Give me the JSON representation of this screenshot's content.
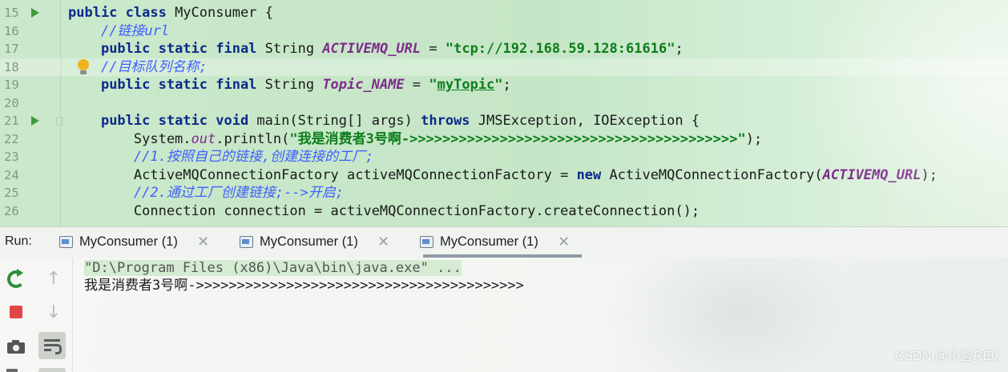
{
  "editor": {
    "lines": [
      {
        "no": "15",
        "run": true,
        "segments": [
          {
            "t": "public class ",
            "c": "kw"
          },
          {
            "t": "MyConsumer {",
            "c": "plain"
          }
        ]
      },
      {
        "no": "16",
        "segments": [
          {
            "t": "    ",
            "c": "plain"
          },
          {
            "t": "//链接url",
            "c": "cmt"
          }
        ]
      },
      {
        "no": "17",
        "segments": [
          {
            "t": "    ",
            "c": "plain"
          },
          {
            "t": "public static final ",
            "c": "kw"
          },
          {
            "t": "String ",
            "c": "plain"
          },
          {
            "t": "ACTIVEMQ_URL",
            "c": "const"
          },
          {
            "t": " = ",
            "c": "plain"
          },
          {
            "t": "\"tcp://192.168.59.128:61616\"",
            "c": "str"
          },
          {
            "t": ";",
            "c": "plain"
          }
        ]
      },
      {
        "no": "18",
        "bulb": true,
        "current": true,
        "segments": [
          {
            "t": "    ",
            "c": "plain"
          },
          {
            "t": "//目标队列名称;",
            "c": "cmt"
          }
        ]
      },
      {
        "no": "19",
        "segments": [
          {
            "t": "    ",
            "c": "plain"
          },
          {
            "t": "public static final ",
            "c": "kw"
          },
          {
            "t": "String ",
            "c": "plain"
          },
          {
            "t": "Topic_NAME",
            "c": "const"
          },
          {
            "t": " = ",
            "c": "plain"
          },
          {
            "t": "\"",
            "c": "str"
          },
          {
            "t": "myTopic",
            "c": "str ul"
          },
          {
            "t": "\"",
            "c": "str"
          },
          {
            "t": ";",
            "c": "plain"
          }
        ]
      },
      {
        "no": "20",
        "segments": []
      },
      {
        "no": "21",
        "run": true,
        "fold": true,
        "segments": [
          {
            "t": "    ",
            "c": "plain"
          },
          {
            "t": "public static void ",
            "c": "kw"
          },
          {
            "t": "main(String[] args) ",
            "c": "plain"
          },
          {
            "t": "throws ",
            "c": "kw"
          },
          {
            "t": "JMSException, IOException {",
            "c": "plain"
          }
        ]
      },
      {
        "no": "22",
        "segments": [
          {
            "t": "        System.",
            "c": "plain"
          },
          {
            "t": "out",
            "c": "static-f"
          },
          {
            "t": ".println(",
            "c": "plain"
          },
          {
            "t": "\"我是消费者3号啊->>>>>>>>>>>>>>>>>>>>>>>>>>>>>>>>>>>>>>>>\"",
            "c": "str"
          },
          {
            "t": ");",
            "c": "plain"
          }
        ]
      },
      {
        "no": "23",
        "segments": [
          {
            "t": "        ",
            "c": "plain"
          },
          {
            "t": "//1.按照自己的链接,创建连接的工厂;",
            "c": "cmt"
          }
        ]
      },
      {
        "no": "24",
        "segments": [
          {
            "t": "        ActiveMQConnectionFactory activeMQConnectionFactory = ",
            "c": "plain"
          },
          {
            "t": "new ",
            "c": "kw"
          },
          {
            "t": "ActiveMQConnectionFactory(",
            "c": "plain"
          },
          {
            "t": "ACTIVEMQ_URL",
            "c": "const"
          },
          {
            "t": ");",
            "c": "plain"
          }
        ]
      },
      {
        "no": "25",
        "segments": [
          {
            "t": "        ",
            "c": "plain"
          },
          {
            "t": "//2.通过工厂创建链接;-->开启;",
            "c": "cmt"
          }
        ]
      },
      {
        "no": "26",
        "segments": [
          {
            "t": "        Connection connection = activeMQConnectionFactory.createConnection();",
            "c": "plain"
          }
        ]
      }
    ]
  },
  "run_panel": {
    "label": "Run:",
    "tabs": [
      {
        "label": "MyConsumer (1)",
        "selected": false
      },
      {
        "label": "MyConsumer (1)",
        "selected": false
      },
      {
        "label": "MyConsumer (1)",
        "selected": true
      }
    ],
    "close_glyph": "✕",
    "console": {
      "command": "\"D:\\Program Files (x86)\\Java\\bin\\java.exe\" ...",
      "output": "我是消费者3号啊->>>>>>>>>>>>>>>>>>>>>>>>>>>>>>>>>>>>>>>>"
    },
    "toolbar": {
      "rerun_icon": "rerun-icon",
      "stop_icon": "stop-icon",
      "screenshot_icon": "camera-icon",
      "up_arrow": "↑",
      "down_arrow": "↓",
      "soft_wrap_icon": "soft-wrap-icon"
    }
  },
  "watermark": "CSDN @小智RE0",
  "colors": {
    "keyword": "#0b2a8c",
    "comment": "#3f5fff",
    "string": "#0d7d1b",
    "constant": "#7d2b8b",
    "run_marker": "#3e9a3e",
    "stop": "#e04545"
  }
}
